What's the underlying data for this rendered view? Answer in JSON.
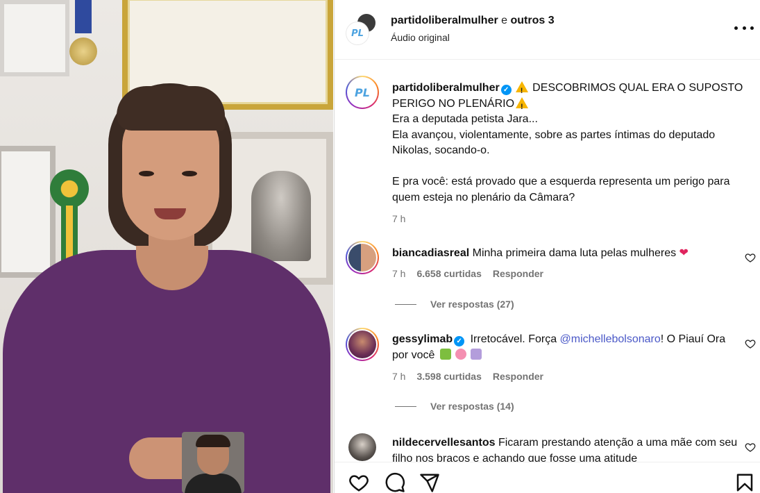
{
  "header": {
    "author": "partidoliberalmulher",
    "connector": " e ",
    "others": "outros 3",
    "audio": "Áudio original",
    "logo_text": "PL"
  },
  "caption": {
    "username": "partidoliberalmulher",
    "line1": " DESCOBRIMOS QUAL ERA O SUPOSTO PERIGO NO PLENÁRIO",
    "line2": "Era a deputada petista Jara...",
    "line3": "Ela avançou, violentamente, sobre as partes íntimas do deputado Nikolas, socando-o.",
    "line4": "E pra você: está provado que a esquerda representa um perigo para quem esteja no plenário da Câmara?",
    "time": "7 h"
  },
  "comments": [
    {
      "username": "biancadiasreal",
      "text": "Minha primeira dama luta pelas mulheres ",
      "emoji": "❤",
      "time": "7 h",
      "likes": "6.658 curtidas",
      "reply": "Responder",
      "view_replies": "Ver respostas (27)"
    },
    {
      "username": "gessylimab",
      "text_before": "Irretocável. Força ",
      "mention": "@michellebolsonaro",
      "text_after": "! O Piauí Ora por você",
      "time": "7 h",
      "likes": "3.598 curtidas",
      "reply": "Responder",
      "view_replies": "Ver respostas (14)"
    },
    {
      "username": "nildecervellesantos",
      "text": "Ficaram prestando atenção a uma mãe com seu filho nos braços e achando que fosse uma atitude"
    }
  ],
  "colors": {
    "link": "#4a58c7",
    "verified": "#0095f6",
    "secondary_text": "#737373"
  },
  "icons": {
    "verified": "verified-badge-icon",
    "warning": "warning-icon",
    "more": "more-options-icon",
    "like": "heart-icon",
    "comment": "comment-icon",
    "share": "share-icon",
    "save": "bookmark-icon"
  }
}
